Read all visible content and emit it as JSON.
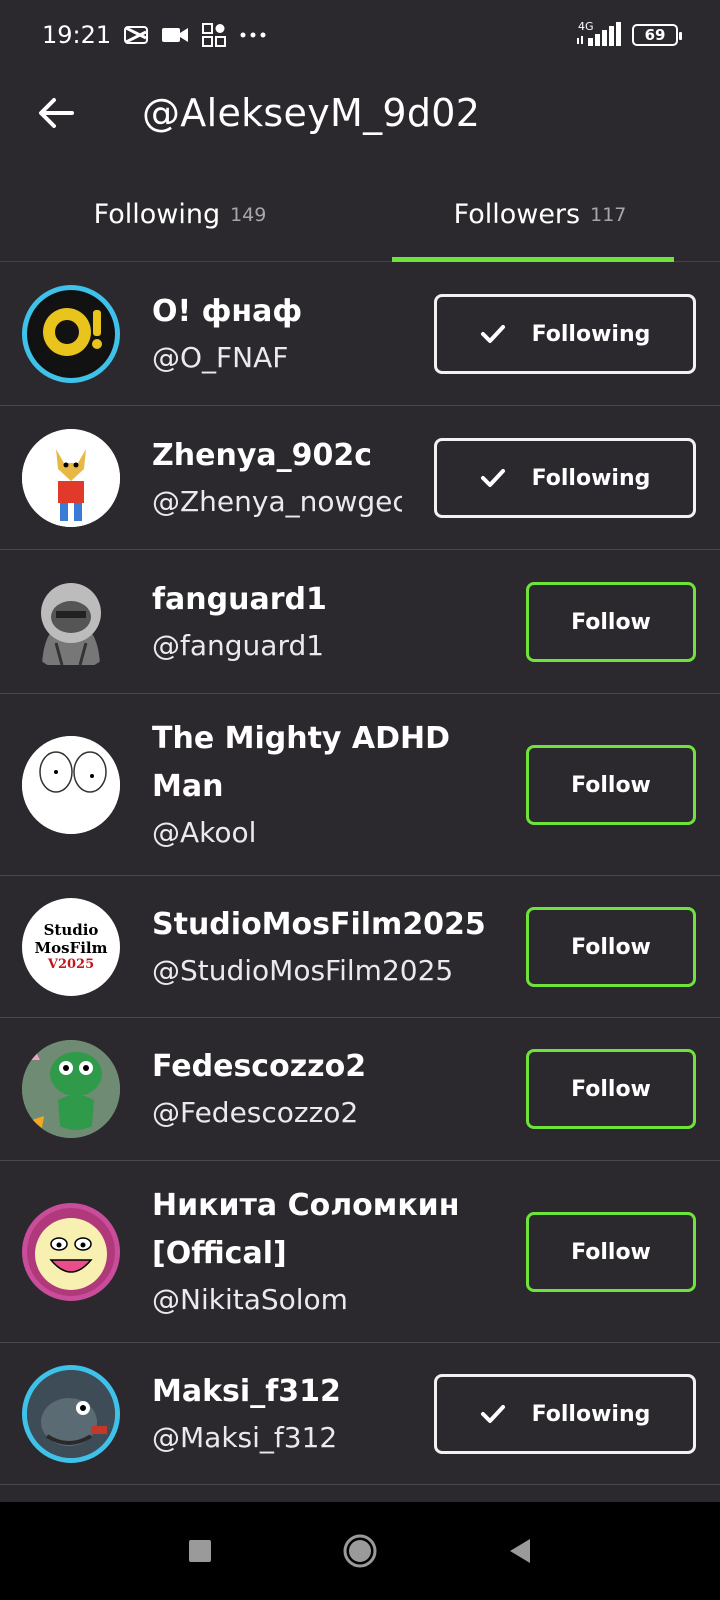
{
  "status_bar": {
    "time": "19:21",
    "network": "4G",
    "battery": "69"
  },
  "header": {
    "title": "@AlekseyM_9d02"
  },
  "tabs": [
    {
      "label": "Following",
      "count": "149",
      "active": false
    },
    {
      "label": "Followers",
      "count": "117",
      "active": true
    }
  ],
  "users": [
    {
      "name": "О! фнаф",
      "handle": "@O_FNAF",
      "button": "Following",
      "avatar_text": "O!"
    },
    {
      "name": "Zhenya_902c",
      "handle": "@Zhenya_nowgec",
      "button": "Following"
    },
    {
      "name": "fanguard1",
      "handle": "@fanguard1",
      "button": "Follow"
    },
    {
      "name": "The Mighty ADHD Man",
      "handle": "@Akool",
      "button": "Follow"
    },
    {
      "name": "StudioMosFilm2025",
      "handle": "@StudioMosFilm2025",
      "button": "Follow",
      "avatar_text_1": "Studio",
      "avatar_text_2": "MosFilm",
      "avatar_text_3": "V2025"
    },
    {
      "name": "Fedescozzo2",
      "handle": "@Fedescozzo2",
      "button": "Follow"
    },
    {
      "name": "Никита Соломкин [Offical]",
      "handle": "@NikitaSolom",
      "button": "Follow"
    },
    {
      "name": "Maksi_f312",
      "handle": "@Maksi_f312",
      "button": "Following"
    }
  ],
  "colors": {
    "background": "#2b292e",
    "accent": "#6ee33a",
    "divider": "#49474d"
  }
}
